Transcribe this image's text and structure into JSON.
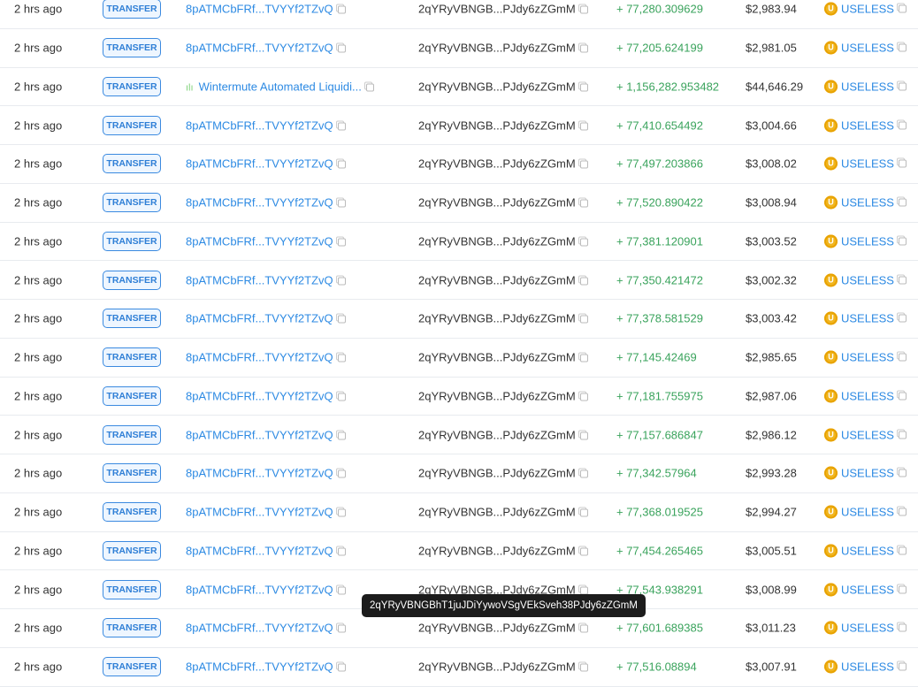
{
  "badge_label": "TRANSFER",
  "token": "USELESS",
  "tooltip": "2qYRyVBNGBhT1juJDiYywoVSgVEkSveh38PJdy6zZGmM",
  "rows": [
    {
      "time": "2 hrs ago",
      "from": "8pATMCbFRf...TVYYf2TZvQ",
      "to": "2qYRyVBNGB...PJdy6zZGmM",
      "amount": "+ 77,280.309629",
      "value": "$2,983.94"
    },
    {
      "time": "2 hrs ago",
      "from": "8pATMCbFRf...TVYYf2TZvQ",
      "to": "2qYRyVBNGB...PJdy6zZGmM",
      "amount": "+ 77,205.624199",
      "value": "$2,981.05"
    },
    {
      "time": "2 hrs ago",
      "from": "Wintermute Automated Liquidi...",
      "from_labeled": true,
      "to": "2qYRyVBNGB...PJdy6zZGmM",
      "amount": "+ 1,156,282.953482",
      "value": "$44,646.29"
    },
    {
      "time": "2 hrs ago",
      "from": "8pATMCbFRf...TVYYf2TZvQ",
      "to": "2qYRyVBNGB...PJdy6zZGmM",
      "amount": "+ 77,410.654492",
      "value": "$3,004.66"
    },
    {
      "time": "2 hrs ago",
      "from": "8pATMCbFRf...TVYYf2TZvQ",
      "to": "2qYRyVBNGB...PJdy6zZGmM",
      "amount": "+ 77,497.203866",
      "value": "$3,008.02"
    },
    {
      "time": "2 hrs ago",
      "from": "8pATMCbFRf...TVYYf2TZvQ",
      "to": "2qYRyVBNGB...PJdy6zZGmM",
      "amount": "+ 77,520.890422",
      "value": "$3,008.94"
    },
    {
      "time": "2 hrs ago",
      "from": "8pATMCbFRf...TVYYf2TZvQ",
      "to": "2qYRyVBNGB...PJdy6zZGmM",
      "amount": "+ 77,381.120901",
      "value": "$3,003.52"
    },
    {
      "time": "2 hrs ago",
      "from": "8pATMCbFRf...TVYYf2TZvQ",
      "to": "2qYRyVBNGB...PJdy6zZGmM",
      "amount": "+ 77,350.421472",
      "value": "$3,002.32"
    },
    {
      "time": "2 hrs ago",
      "from": "8pATMCbFRf...TVYYf2TZvQ",
      "to": "2qYRyVBNGB...PJdy6zZGmM",
      "amount": "+ 77,378.581529",
      "value": "$3,003.42"
    },
    {
      "time": "2 hrs ago",
      "from": "8pATMCbFRf...TVYYf2TZvQ",
      "to": "2qYRyVBNGB...PJdy6zZGmM",
      "amount": "+ 77,145.42469",
      "value": "$2,985.65"
    },
    {
      "time": "2 hrs ago",
      "from": "8pATMCbFRf...TVYYf2TZvQ",
      "to": "2qYRyVBNGB...PJdy6zZGmM",
      "amount": "+ 77,181.755975",
      "value": "$2,987.06"
    },
    {
      "time": "2 hrs ago",
      "from": "8pATMCbFRf...TVYYf2TZvQ",
      "to": "2qYRyVBNGB...PJdy6zZGmM",
      "amount": "+ 77,157.686847",
      "value": "$2,986.12"
    },
    {
      "time": "2 hrs ago",
      "from": "8pATMCbFRf...TVYYf2TZvQ",
      "to": "2qYRyVBNGB...PJdy6zZGmM",
      "amount": "+ 77,342.57964",
      "value": "$2,993.28"
    },
    {
      "time": "2 hrs ago",
      "from": "8pATMCbFRf...TVYYf2TZvQ",
      "to": "2qYRyVBNGB...PJdy6zZGmM",
      "amount": "+ 77,368.019525",
      "value": "$2,994.27"
    },
    {
      "time": "2 hrs ago",
      "from": "8pATMCbFRf...TVYYf2TZvQ",
      "to": "2qYRyVBNGB...PJdy6zZGmM",
      "amount": "+ 77,454.265465",
      "value": "$3,005.51"
    },
    {
      "time": "2 hrs ago",
      "from": "8pATMCbFRf...TVYYf2TZvQ",
      "to": "2qYRyVBNGB...PJdy6zZGmM",
      "amount": "+ 77,543.938291",
      "value": "$3,008.99"
    },
    {
      "time": "2 hrs ago",
      "from": "8pATMCbFRf...TVYYf2TZvQ",
      "to": "2qYRyVBNGB...PJdy6zZGmM",
      "amount": "+ 77,601.689385",
      "value": "$3,011.23"
    },
    {
      "time": "2 hrs ago",
      "from": "8pATMCbFRf...TVYYf2TZvQ",
      "to": "2qYRyVBNGB...PJdy6zZGmM",
      "amount": "+ 77,516.08894",
      "value": "$3,007.91"
    }
  ]
}
